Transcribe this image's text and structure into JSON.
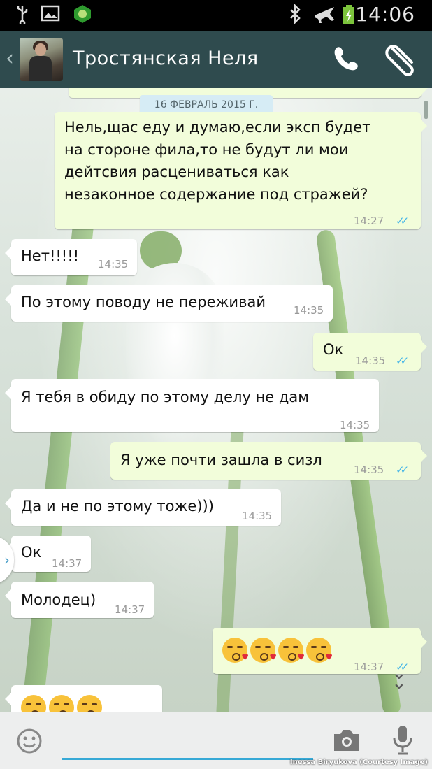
{
  "status_bar": {
    "time": "14:06",
    "icons": [
      "usb-icon",
      "image-icon",
      "app-icon",
      "bluetooth-icon",
      "airplane-icon",
      "battery-icon"
    ]
  },
  "header": {
    "contact_name": "Тростянская Неля",
    "icons": [
      "back-icon",
      "avatar",
      "phone-icon",
      "attach-icon"
    ]
  },
  "chat": {
    "date_label": "16 ФЕВРАЛЬ 2015 Г.",
    "messages": [
      {
        "side": "out",
        "lines": [
          "Нель,щас еду и думаю,если эксп будет",
          "на стороне фила,то не будут ли мои",
          "дейтсвия расцениваться как",
          "незаконное содержание под стражей?"
        ],
        "time": "14:27",
        "read": true
      },
      {
        "side": "in",
        "text": "Нет!!!!!",
        "time": "14:35"
      },
      {
        "side": "in",
        "text": "По этому поводу не переживай",
        "time": "14:35"
      },
      {
        "side": "out",
        "text": "Ок",
        "time": "14:35",
        "read": true
      },
      {
        "side": "in",
        "text": "Я тебя в обиду по этому делу не дам",
        "time": "14:35"
      },
      {
        "side": "out",
        "text": "Я уже почти зашла в сизл",
        "time": "14:35",
        "read": true
      },
      {
        "side": "in",
        "text": "Да и не по этому тоже)))",
        "time": "14:35"
      },
      {
        "side": "in",
        "text": "Ок",
        "time": "14:37"
      },
      {
        "side": "in",
        "text": "Молодец)",
        "time": "14:37"
      },
      {
        "side": "out",
        "emoji": [
          "kissing-heart",
          "kissing-heart",
          "kissing-heart",
          "kissing-heart"
        ],
        "time": "14:37",
        "read": true
      },
      {
        "side": "in",
        "emoji": [
          "kissing",
          "kissing",
          "kissing"
        ]
      }
    ]
  },
  "input": {
    "placeholder": "",
    "icons": [
      "emoji-icon",
      "camera-icon",
      "microphone-icon"
    ]
  },
  "credit": "Inessa Biryukova (Courtesy Image)",
  "colors": {
    "header": "#2f4b4e",
    "outgoing": "#f2fdda",
    "incoming": "#ffffff",
    "ticks": "#44b5e8",
    "input_underline": "#37a9d6"
  }
}
